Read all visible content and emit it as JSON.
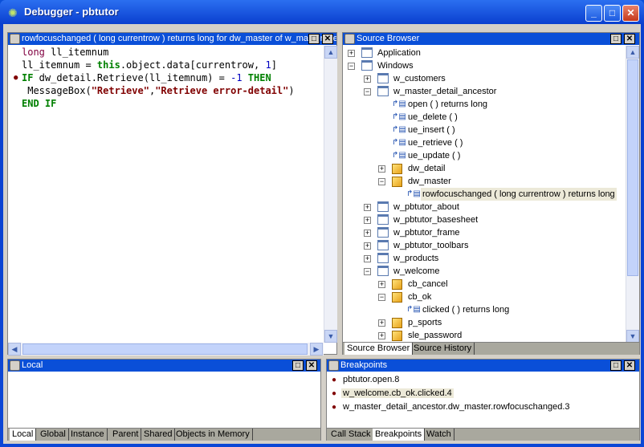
{
  "window": {
    "title": "Debugger - pbtutor",
    "icon": "bug-icon"
  },
  "script_pane": {
    "title": "rowfocuschanged ( long currentrow )  returns long for dw_master of w_master_detail_ancestor",
    "lines": [
      {
        "parts": [
          {
            "t": "long",
            "c": "ty"
          },
          {
            "t": " ll_itemnum",
            "c": ""
          }
        ]
      },
      {
        "parts": [
          {
            "t": "ll_itemnum = ",
            "c": ""
          },
          {
            "t": "this",
            "c": "kw"
          },
          {
            "t": ".object.data[currentrow, ",
            "c": ""
          },
          {
            "t": "1",
            "c": "num"
          },
          {
            "t": "]",
            "c": ""
          }
        ]
      },
      {
        "breakpoint": true,
        "parts": [
          {
            "t": "IF",
            "c": "kw"
          },
          {
            "t": " dw_detail.Retrieve(ll_itemnum) = ",
            "c": ""
          },
          {
            "t": "-1",
            "c": "num"
          },
          {
            "t": " ",
            "c": ""
          },
          {
            "t": "THEN",
            "c": "kw"
          }
        ]
      },
      {
        "parts": [
          {
            "t": " MessageBox(",
            "c": ""
          },
          {
            "t": "\"Retrieve\"",
            "c": "str"
          },
          {
            "t": ",",
            "c": ""
          },
          {
            "t": "\"Retrieve error-detail\"",
            "c": "str"
          },
          {
            "t": ")",
            "c": ""
          }
        ]
      },
      {
        "parts": [
          {
            "t": "END IF",
            "c": "kw"
          }
        ]
      }
    ]
  },
  "source_browser": {
    "title": "Source Browser",
    "tree": [
      {
        "label": "Application",
        "level": 0,
        "exp": "+",
        "icon": "app"
      },
      {
        "label": "Windows",
        "level": 0,
        "exp": "-",
        "icon": "win"
      },
      {
        "label": "w_customers",
        "level": 1,
        "exp": "+",
        "icon": "win"
      },
      {
        "label": "w_master_detail_ancestor",
        "level": 1,
        "exp": "-",
        "icon": "win"
      },
      {
        "label": "open ( )  returns long",
        "level": 2,
        "icon": "fn"
      },
      {
        "label": "ue_delete ( )",
        "level": 2,
        "icon": "fn"
      },
      {
        "label": "ue_insert ( )",
        "level": 2,
        "icon": "fn"
      },
      {
        "label": "ue_retrieve ( )",
        "level": 2,
        "icon": "fn"
      },
      {
        "label": "ue_update ( )",
        "level": 2,
        "icon": "fn"
      },
      {
        "label": "dw_detail",
        "level": 2,
        "exp": "+",
        "icon": "obj"
      },
      {
        "label": "dw_master",
        "level": 2,
        "exp": "-",
        "icon": "obj"
      },
      {
        "label": "rowfocuschanged ( long currentrow )  returns long",
        "level": 3,
        "icon": "fn",
        "selected": true
      },
      {
        "label": "w_pbtutor_about",
        "level": 1,
        "exp": "+",
        "icon": "win"
      },
      {
        "label": "w_pbtutor_basesheet",
        "level": 1,
        "exp": "+",
        "icon": "win"
      },
      {
        "label": "w_pbtutor_frame",
        "level": 1,
        "exp": "+",
        "icon": "win"
      },
      {
        "label": "w_pbtutor_toolbars",
        "level": 1,
        "exp": "+",
        "icon": "win"
      },
      {
        "label": "w_products",
        "level": 1,
        "exp": "+",
        "icon": "win"
      },
      {
        "label": "w_welcome",
        "level": 1,
        "exp": "-",
        "icon": "win"
      },
      {
        "label": "cb_cancel",
        "level": 2,
        "exp": "+",
        "icon": "obj"
      },
      {
        "label": "cb_ok",
        "level": 2,
        "exp": "-",
        "icon": "obj"
      },
      {
        "label": "clicked ( )  returns long",
        "level": 3,
        "icon": "fn"
      },
      {
        "label": "p_sports",
        "level": 2,
        "exp": "+",
        "icon": "obj"
      },
      {
        "label": "sle_password",
        "level": 2,
        "exp": "+",
        "icon": "obj"
      }
    ],
    "tabs": [
      "Source Browser",
      "Source History"
    ]
  },
  "local_pane": {
    "title": "Local",
    "tabs": [
      "Local",
      "Global",
      "Instance",
      "Parent",
      "Shared",
      "Objects in Memory"
    ]
  },
  "breakpoints_pane": {
    "title": "Breakpoints",
    "items": [
      "pbtutor.open.8",
      "w_welcome.cb_ok.clicked.4",
      "w_master_detail_ancestor.dw_master.rowfocuschanged.3"
    ],
    "tabs": [
      "Call Stack",
      "Breakpoints",
      "Watch"
    ]
  }
}
